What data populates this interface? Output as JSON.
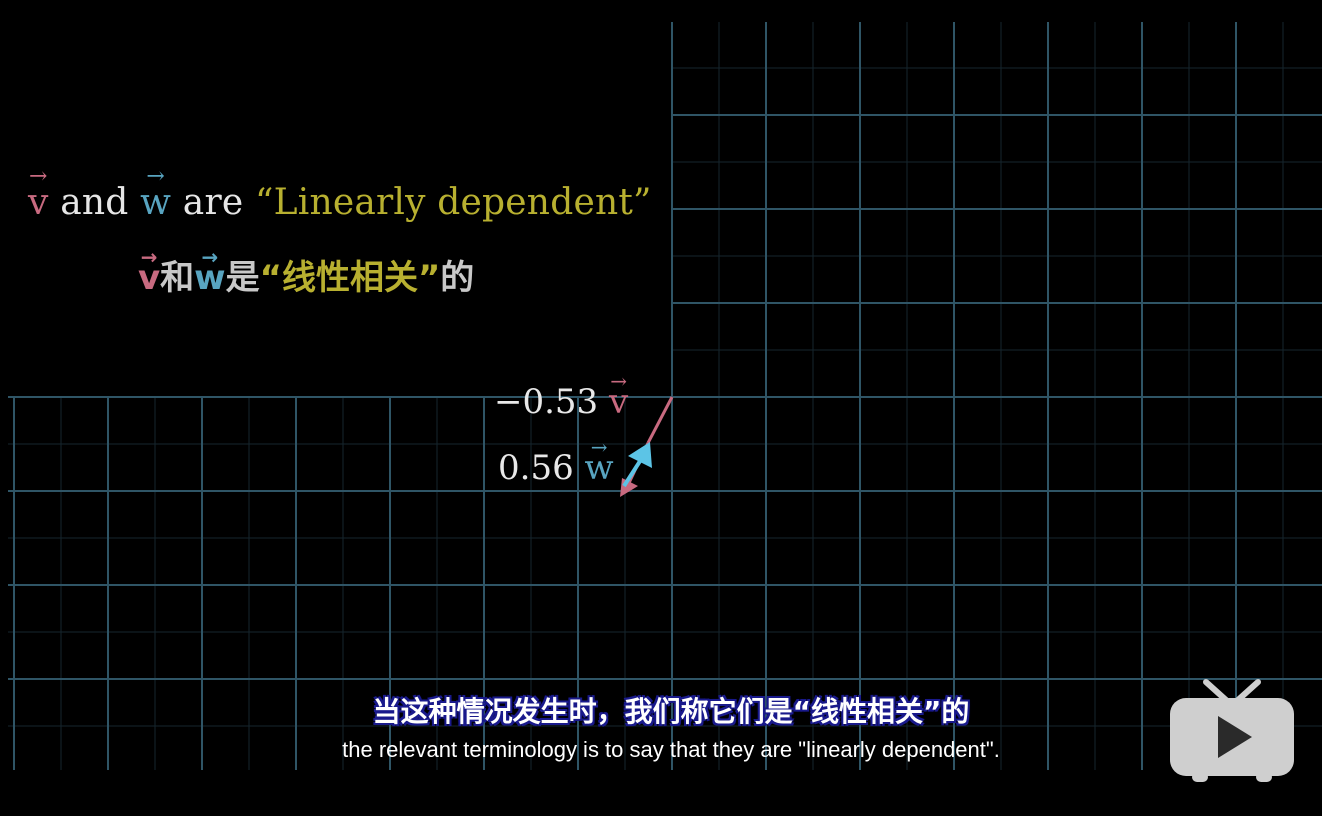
{
  "title_en": {
    "v": "v",
    "and": " and ",
    "w": "w",
    "are": " are ",
    "quote_phrase": "“Linearly dependent”"
  },
  "title_cn": {
    "v": "v",
    "he": "和",
    "w": "w",
    "shi": "是",
    "quote_phrase": "“线性相关”",
    "de": "的"
  },
  "coefficients": {
    "v_coef": "−0.53",
    "v_label": "v",
    "w_coef": "0.56",
    "w_label": "w"
  },
  "subtitles": {
    "chinese": "当这种情况发生时，我们称它们是“线性相关”的",
    "english": "the relevant terminology is to say that they are \"linearly dependent\"."
  },
  "colors": {
    "v_vector": "#c86a80",
    "w_vector": "#5cc4e6",
    "grid_major": "#2f5566",
    "grid_minor": "#16262e",
    "text_yellow": "#b8b030"
  },
  "icons": {
    "player_logo": "tv-play-icon"
  }
}
